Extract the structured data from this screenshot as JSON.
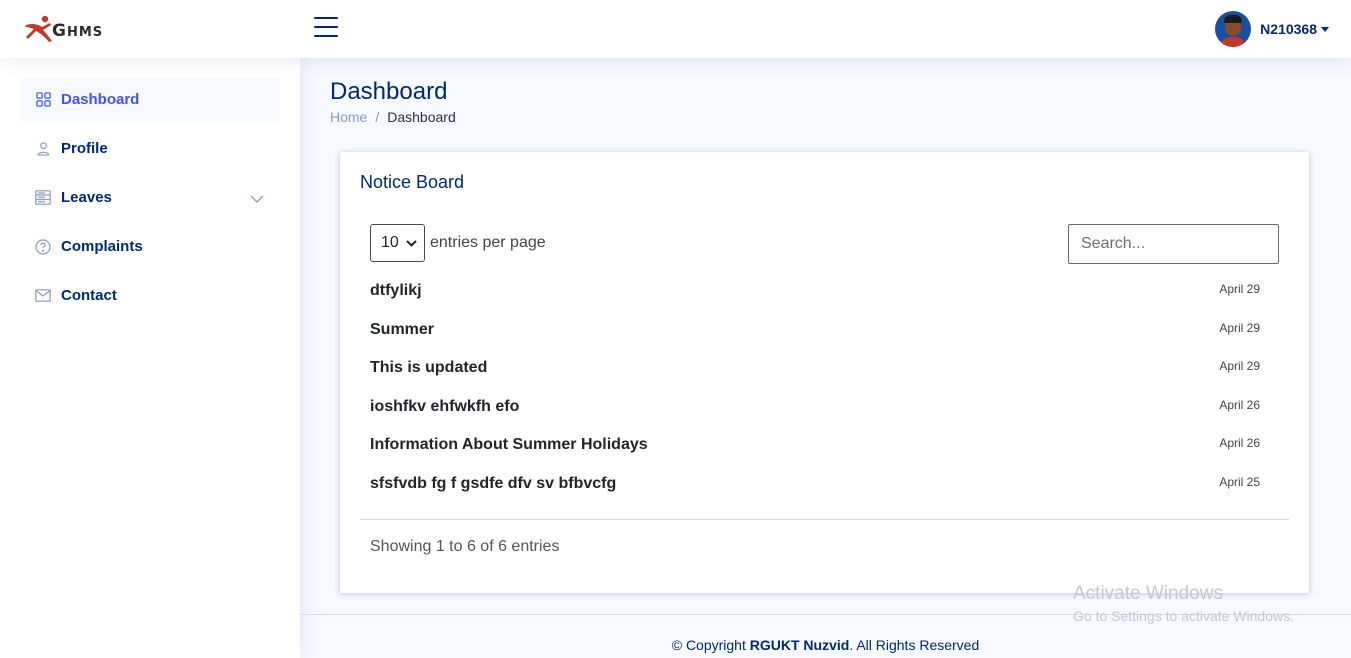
{
  "header": {
    "logo_text_big": "G",
    "logo_text_small": "HMS",
    "user_name": "N210368"
  },
  "sidebar": {
    "items": [
      {
        "label": "Dashboard",
        "icon": "grid-icon",
        "active": true
      },
      {
        "label": "Profile",
        "icon": "person-icon"
      },
      {
        "label": "Leaves",
        "icon": "layout-text-icon",
        "has_submenu": true
      },
      {
        "label": "Complaints",
        "icon": "question-circle-icon"
      },
      {
        "label": "Contact",
        "icon": "envelope-icon"
      }
    ]
  },
  "page": {
    "title": "Dashboard",
    "breadcrumb": {
      "home": "Home",
      "separator": "/",
      "current": "Dashboard"
    }
  },
  "notice_board": {
    "title": "Notice Board",
    "per_page_value": "10",
    "per_page_label": "entries per page",
    "search_placeholder": "Search...",
    "rows": [
      {
        "title": "dtfylikj",
        "date": "April 29"
      },
      {
        "title": "Summer",
        "date": "April 29"
      },
      {
        "title": "This is updated",
        "date": "April 29"
      },
      {
        "title": "ioshfkv ehfwkfh efo",
        "date": "April 26"
      },
      {
        "title": "Information About Summer Holidays",
        "date": "April 26"
      },
      {
        "title": "sfsfvdb fg f gsdfe dfv sv bfbvcfg",
        "date": "April 25"
      }
    ],
    "info": "Showing 1 to 6 of 6 entries"
  },
  "footer": {
    "prefix": "© Copyright ",
    "org": "RGUKT Nuzvid",
    "suffix": ". All Rights Reserved"
  },
  "watermark": {
    "line1": "Activate Windows",
    "line2": "Go to Settings to activate Windows."
  },
  "colors": {
    "primary": "#012970",
    "accent": "#4154f1",
    "background": "#f6f9ff"
  }
}
